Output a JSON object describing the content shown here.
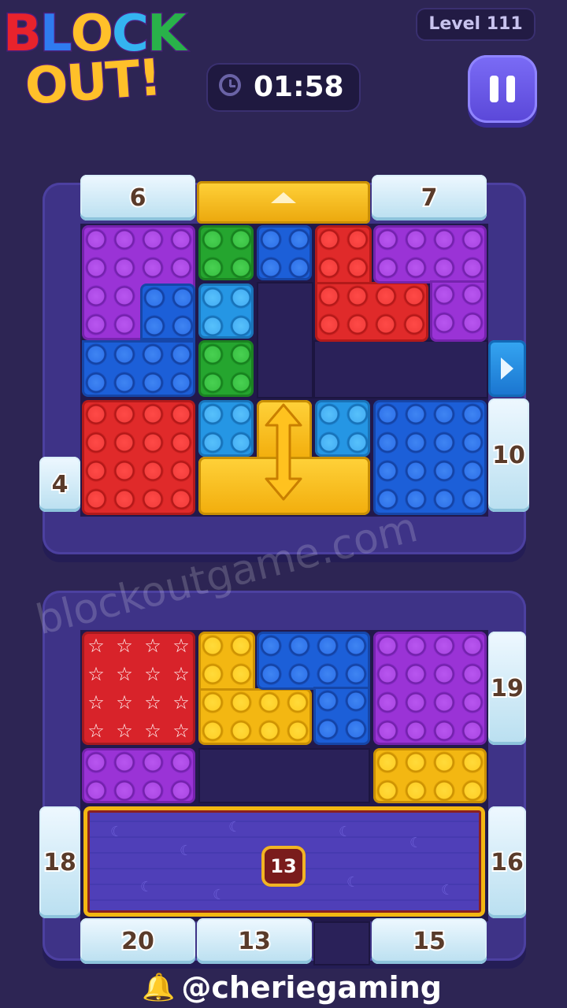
{
  "logo": {
    "line1": [
      "B",
      "L",
      "O",
      "C",
      "K"
    ],
    "line2": "OUT!",
    "line1_colors": [
      "#e8232c",
      "#2f7bf0",
      "#ffc02a",
      "#34b4f0",
      "#29b24a"
    ]
  },
  "header": {
    "level_label": "Level 111",
    "timer": "01:58"
  },
  "board_top": {
    "tiles": {
      "top_left": "6",
      "top_right": "7",
      "left": "4",
      "right": "10"
    },
    "slider_icon": "double-arrow-vertical-icon",
    "exit_icon": "triangle-up-icon",
    "side_icon": "play-right-icon"
  },
  "board_bottom": {
    "tiles": {
      "right_top": "19",
      "left_mid": "18",
      "right_mid": "16",
      "bottom_1": "20",
      "bottom_2": "13",
      "bottom_3": "15"
    },
    "mat_badge": "13",
    "star_icon": "☆"
  },
  "watermark": "blockoutgame.com",
  "footer": {
    "handle": "@cheriegaming",
    "icon": "bell-icon"
  }
}
